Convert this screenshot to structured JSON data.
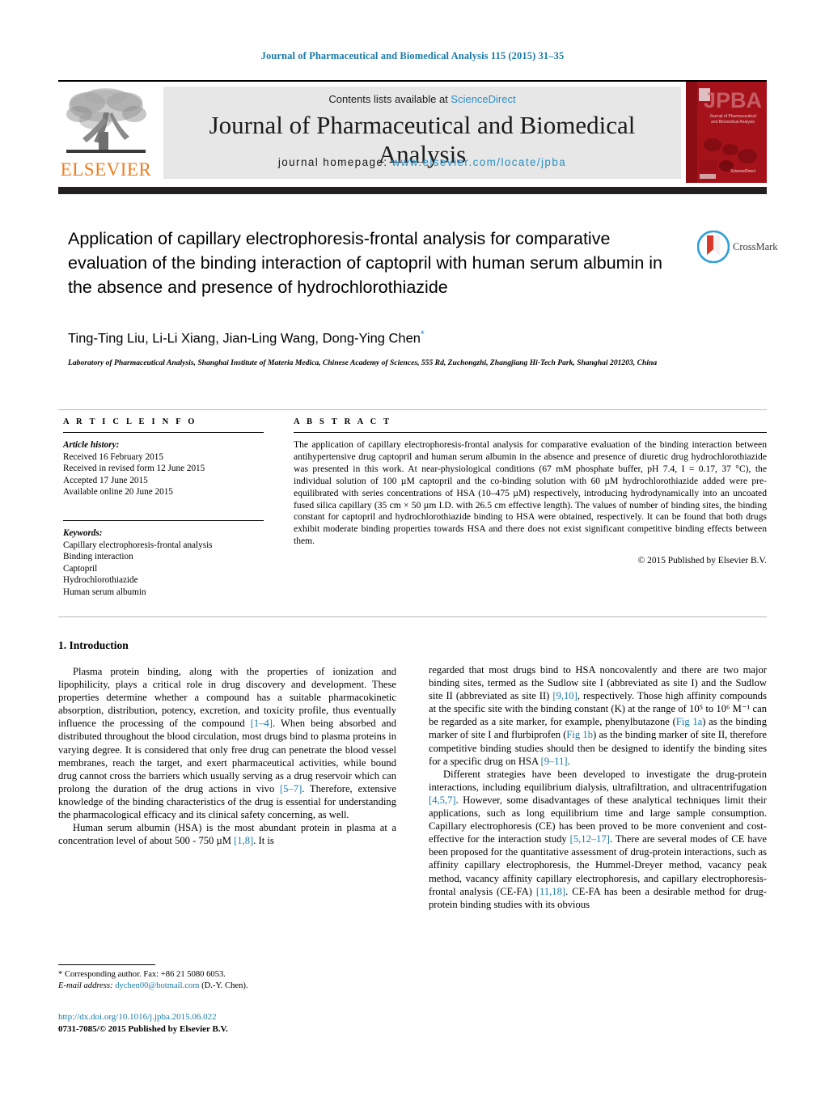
{
  "running_head": "Journal of Pharmaceutical and Biomedical Analysis 115 (2015) 31–35",
  "colors": {
    "link_blue": "#1a7aa8",
    "sciencedirect_blue": "#2a8fc4",
    "elsevier_orange": "#f07c1e",
    "cover_red": "#a5121a",
    "banner_grey": "#e7e7e7",
    "black_bar": "#231f20"
  },
  "header": {
    "publisher_name": "ELSEVIER",
    "contents_prefix": "Contents lists available at ",
    "contents_link": "ScienceDirect",
    "journal_title": "Journal of Pharmaceutical and Biomedical Analysis",
    "homepage_label": "journal homepage:",
    "homepage_url": "www.elsevier.com/locate/jpba",
    "cover_title": "JPBA",
    "cover_subtitle": "Journal of Pharmaceutical and Biomedical Analysis"
  },
  "crossmark": {
    "label": "CrossMark"
  },
  "article": {
    "title": "Application of capillary electrophoresis-frontal analysis for comparative evaluation of the binding interaction of captopril with human serum albumin in the absence and presence of hydrochlorothiazide",
    "authors": "Ting-Ting Liu, Li-Li Xiang, Jian-Ling Wang, Dong-Ying Chen",
    "corresponding_marker": "*",
    "affiliation": "Laboratory of Pharmaceutical Analysis, Shanghai Institute of Materia Medica, Chinese Academy of Sciences, 555 Rd, Zuchongzhi, Zhangjiang Hi-Tech Park, Shanghai 201203, China"
  },
  "article_info": {
    "heading": "A R T I C L E   I N F O",
    "history_label": "Article history:",
    "history": [
      "Received 16 February 2015",
      "Received in revised form 12 June 2015",
      "Accepted 17 June 2015",
      "Available online 20 June 2015"
    ],
    "keywords_label": "Keywords:",
    "keywords": [
      "Capillary electrophoresis-frontal analysis",
      "Binding interaction",
      "Captopril",
      "Hydrochlorothiazide",
      "Human serum albumin"
    ]
  },
  "abstract": {
    "heading": "A B S T R A C T",
    "text": "The application of capillary electrophoresis-frontal analysis for comparative evaluation of the binding interaction between antihypertensive drug captopril and human serum albumin in the absence and presence of diuretic drug hydrochlorothiazide was presented in this work. At near-physiological conditions (67 mM phosphate buffer, pH 7.4, I = 0.17, 37 °C), the individual solution of 100 µM captopril and the co-binding solution with 60 µM hydrochlorothiazide added were pre-equilibrated with series concentrations of HSA (10–475 µM) respectively, introducing hydrodynamically into an uncoated fused silica capillary (35 cm × 50 µm I.D. with 26.5 cm effective length). The values of number of binding sites, the binding constant for captopril and hydrochlorothiazide binding to HSA were obtained, respectively. It can be found that both drugs exhibit moderate binding properties towards HSA and there does not exist significant competitive binding effects between them.",
    "copyright": "© 2015 Published by Elsevier B.V."
  },
  "body": {
    "section_number_title": "1.  Introduction",
    "left_paragraph_1": "Plasma protein binding, along with the properties of ionization and lipophilicity, plays a critical role in drug discovery and development. These properties determine whether a compound has a suitable pharmacokinetic absorption, distribution, potency, excretion, and toxicity profile, thus eventually influence the processing of the compound [1–4]. When being absorbed and distributed throughout the blood circulation, most drugs bind to plasma proteins in varying degree. It is considered that only free drug can penetrate the blood vessel membranes, reach the target, and exert pharmaceutical activities, while bound drug cannot cross the barriers which usually serving as a drug reservoir which can prolong the duration of the drug actions in vivo [5–7]. Therefore, extensive knowledge of the binding characteristics of the drug is essential for understanding the pharmacological efficacy and its clinical safety concerning, as well.",
    "left_paragraph_2": "Human serum albumin (HSA) is the most abundant protein in plasma at a concentration level of about 500 - 750 µM [1,8]. It is",
    "right_paragraph_1": "regarded that most drugs bind to HSA noncovalently and there are two major binding sites, termed as the Sudlow site I (abbreviated as site I) and the Sudlow site II (abbreviated as site II) [9,10], respectively. Those high affinity compounds at the specific site with the binding constant (K) at the range of 10⁵ to 10⁶ M⁻¹ can be regarded as a site marker, for example, phenylbutazone (Fig 1a) as the binding marker of site I and flurbiprofen (Fig 1b) as the binding marker of site II, therefore competitive binding studies should then be designed to identify the binding sites for a specific drug on HSA [9–11].",
    "right_paragraph_2": "Different strategies have been developed to investigate the drug-protein interactions, including equilibrium dialysis, ultrafiltration, and ultracentrifugation [4,5,7]. However, some disadvantages of these analytical techniques limit their applications, such as long equilibrium time and large sample consumption. Capillary electrophoresis (CE) has been proved to be more convenient and cost-effective for the interaction study [5,12–17]. There are several modes of CE have been proposed for the quantitative assessment of drug-protein interactions, such as affinity capillary electrophoresis, the Hummel-Dreyer method, vacancy peak method, vacancy affinity capillary electrophoresis, and capillary electrophoresis-frontal analysis (CE-FA) [11,18]. CE-FA has been a desirable method for drug-protein binding studies with its obvious"
  },
  "footnotes": {
    "corresponding": "* Corresponding author. Fax: +86 21 5080 6053.",
    "email_label": "E-mail address:",
    "email": "dychen00@hotmail.com",
    "email_suffix": "(D.-Y. Chen).",
    "doi": "http://dx.doi.org/10.1016/j.jpba.2015.06.022",
    "issn_line": "0731-7085/© 2015 Published by Elsevier B.V."
  }
}
